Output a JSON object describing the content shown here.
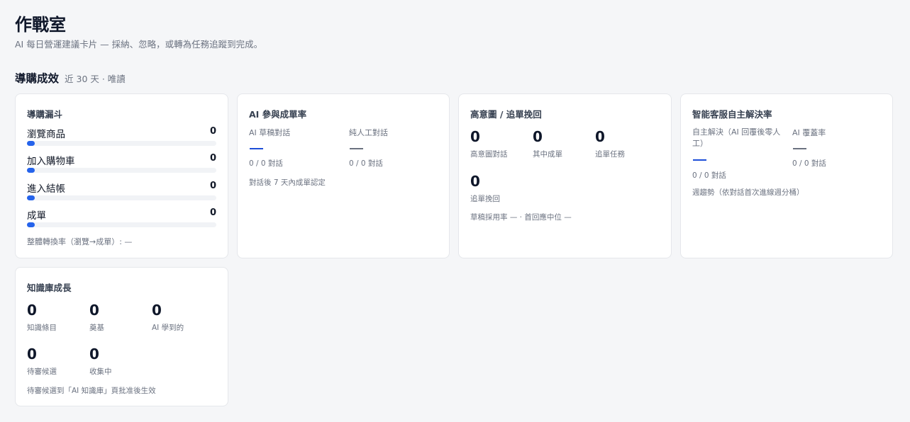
{
  "header": {
    "title": "作戰室",
    "subtitle": "AI 每日營運建議卡片 — 採納、忽略，或轉為任務追蹤到完成。"
  },
  "section": {
    "title": "導購成效",
    "meta": "近 30 天 · 唯讀"
  },
  "funnel": {
    "title": "導購漏斗",
    "items": [
      {
        "label": "瀏覽商品",
        "value": "0",
        "fraction": 0
      },
      {
        "label": "加入購物車",
        "value": "0",
        "fraction": 0
      },
      {
        "label": "進入結帳",
        "value": "0",
        "fraction": 0
      },
      {
        "label": "成單",
        "value": "0",
        "fraction": 0
      }
    ],
    "footer": "整體轉換率（瀏覽→成單）: —"
  },
  "ai_conversion": {
    "title": "AI 參與成單率",
    "cols": [
      {
        "label": "AI 草稿對話",
        "ratio": "0 / 0 對話"
      },
      {
        "label": "純人工對話",
        "ratio": "0 / 0 對話"
      }
    ],
    "note": "對話後 7 天內成單認定"
  },
  "high_intent": {
    "title": "高意圖 / 追單挽回",
    "stats": [
      {
        "value": "0",
        "label": "高意圖對話"
      },
      {
        "value": "0",
        "label": "其中成單"
      },
      {
        "value": "0",
        "label": "追單任務"
      },
      {
        "value": "0",
        "label": "追單挽回"
      }
    ],
    "note": "草稿採用率 — · 首回應中位 —"
  },
  "support": {
    "title": "智能客服自主解決率",
    "cols": [
      {
        "label": "自主解決（AI 回覆後零人工）",
        "ratio": "0 / 0 對話"
      },
      {
        "label": "AI 覆蓋率",
        "ratio": "0 / 0 對話"
      }
    ],
    "note": "週趨勢（依對話首次進線週分桶）"
  },
  "knowledge": {
    "title": "知識庫成長",
    "stats": [
      {
        "value": "0",
        "label": "知識條目"
      },
      {
        "value": "0",
        "label": "奠基"
      },
      {
        "value": "0",
        "label": "AI 學到的"
      },
      {
        "value": "0",
        "label": "待審候選"
      },
      {
        "value": "0",
        "label": "收集中"
      }
    ],
    "note": "待審候選到「AI 知識庫」頁批准後生效"
  },
  "colors": {
    "accent": "#2563eb",
    "background": "#f5f6f8",
    "card": "#ffffff"
  }
}
